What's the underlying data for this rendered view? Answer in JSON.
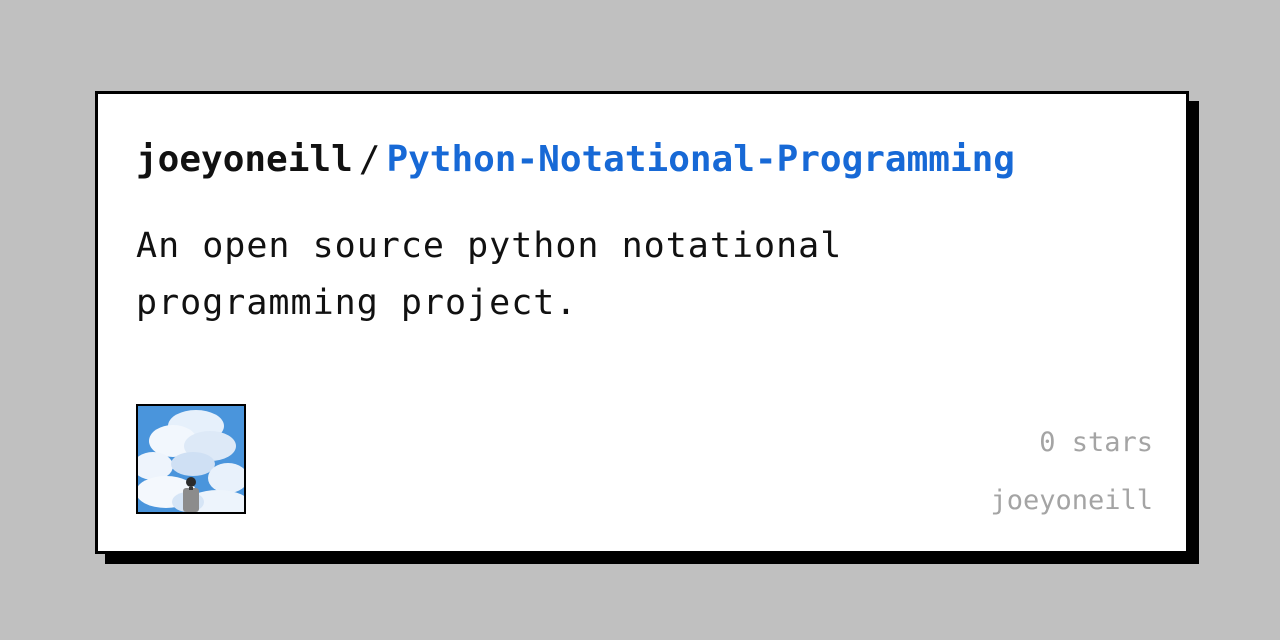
{
  "card": {
    "owner": "joeyoneill",
    "separator": "/",
    "repo": "Python-Notational-Programming",
    "description": "An open source python notational programming project.",
    "stars_text": "0 stars",
    "author": "joeyoneill",
    "avatar_icon": "sky-clouds-person-avatar-icon"
  },
  "colors": {
    "background": "#c0c0c0",
    "card": "#ffffff",
    "border": "#000000",
    "repo_link": "#1769d6",
    "muted_text": "#a4a4a4"
  }
}
